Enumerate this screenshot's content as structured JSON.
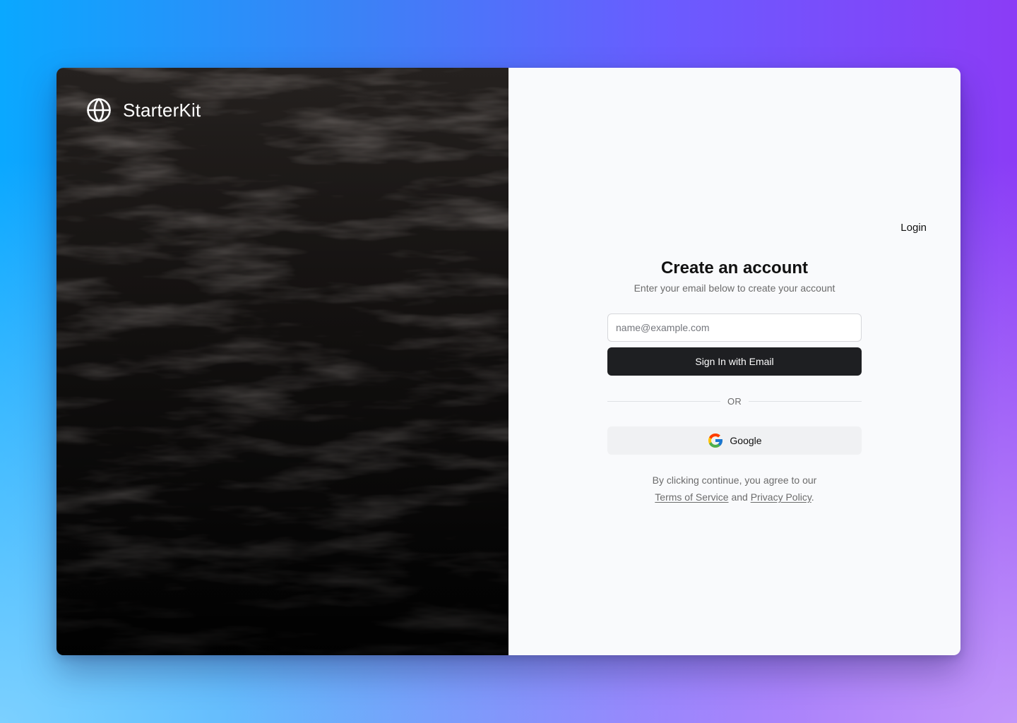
{
  "brand": {
    "name": "StarterKit",
    "icon": "globe-icon"
  },
  "nav": {
    "login_label": "Login"
  },
  "signup": {
    "title": "Create an account",
    "subtitle": "Enter your email below to create your account",
    "email_placeholder": "name@example.com",
    "email_value": "",
    "submit_label": "Sign In with Email",
    "divider_label": "OR",
    "google_label": "Google",
    "google_icon": "google-icon"
  },
  "legal": {
    "prefix": "By clicking continue, you agree to our",
    "terms_label": "Terms of Service",
    "and": "and",
    "privacy_label": "Privacy Policy",
    "suffix": "."
  },
  "colors": {
    "primary_button": "#1e1f22",
    "panel_background": "#f9fafc",
    "secondary_button": "#f0f1f3"
  }
}
